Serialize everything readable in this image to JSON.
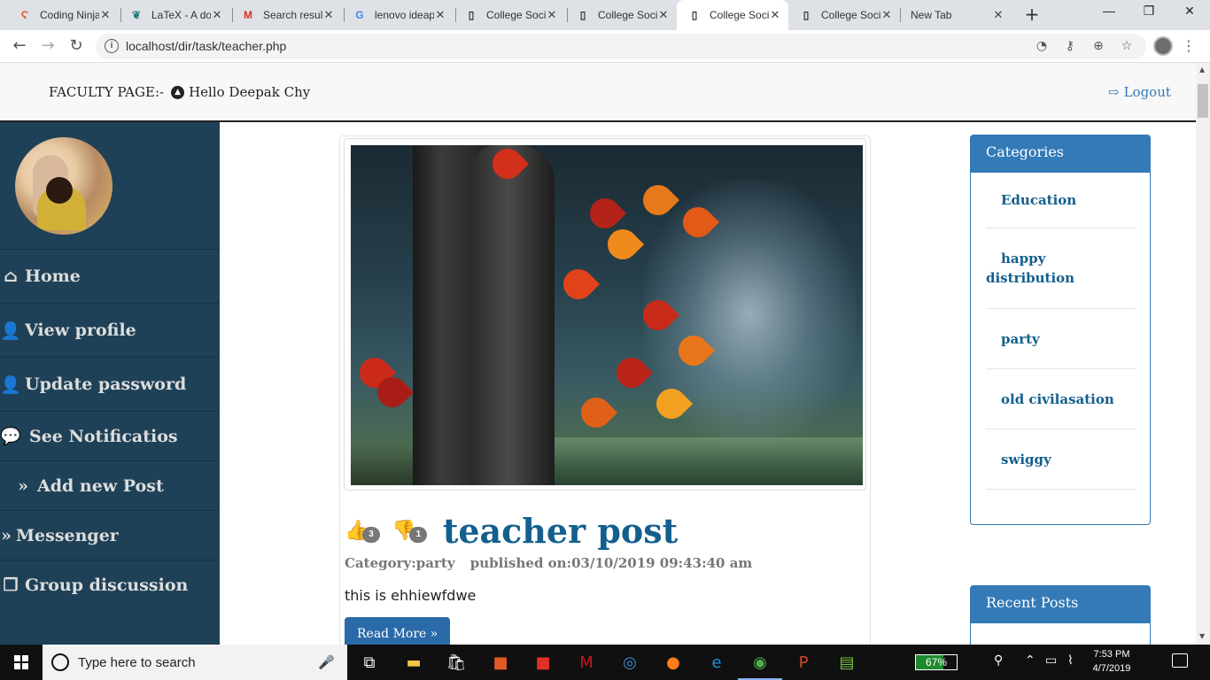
{
  "browser": {
    "tabs": [
      {
        "title": "Coding Ninjas",
        "icon": "coding-ninjas-icon"
      },
      {
        "title": "LaTeX - A document",
        "icon": "overleaf-icon"
      },
      {
        "title": "Search results",
        "icon": "gmail-icon"
      },
      {
        "title": "lenovo ideapad",
        "icon": "google-icon"
      },
      {
        "title": "College Social",
        "icon": "page-icon"
      },
      {
        "title": "College Social",
        "icon": "page-icon"
      },
      {
        "title": "College Social",
        "icon": "page-icon"
      },
      {
        "title": "College Social",
        "icon": "page-icon"
      },
      {
        "title": "New Tab",
        "icon": ""
      }
    ],
    "url": "localhost/dir/task/teacher.php"
  },
  "header": {
    "faculty_label": "FACULTY PAGE:-",
    "greeting": "Hello Deepak Chy",
    "logout_label": "Logout"
  },
  "sidebar": {
    "items": [
      {
        "label": "Home",
        "icon": "home-icon"
      },
      {
        "label": "View profile",
        "icon": "user-icon"
      },
      {
        "label": "Update password",
        "icon": "user-icon"
      },
      {
        "label": "See Notificatios",
        "icon": "comments-icon"
      },
      {
        "label": "Add new Post",
        "icon": "chevron-double-down-icon"
      },
      {
        "label": "Messenger",
        "icon": "chevron-double-down-icon"
      },
      {
        "label": "Group discussion",
        "icon": "windows-icon"
      }
    ]
  },
  "post": {
    "likes": "3",
    "dislikes": "1",
    "title": "teacher post",
    "category": "Category:party",
    "published": "published on:03/10/2019 09:43:40 am",
    "body": "this is ehhiewfdwe",
    "read_more": "Read More »"
  },
  "categories": {
    "title": "Categories",
    "items": [
      "Education",
      "happy distribution",
      "party",
      "old civilasation",
      "swiggy"
    ]
  },
  "recent_posts": {
    "title": "Recent Posts"
  },
  "taskbar": {
    "search_placeholder": "Type here to search",
    "battery": "67%",
    "time": "7:53 PM",
    "date": "4/7/2019"
  },
  "colors": {
    "sidebar_bg": "#1f4157",
    "accent": "#337ab7",
    "title": "#135f8d"
  }
}
